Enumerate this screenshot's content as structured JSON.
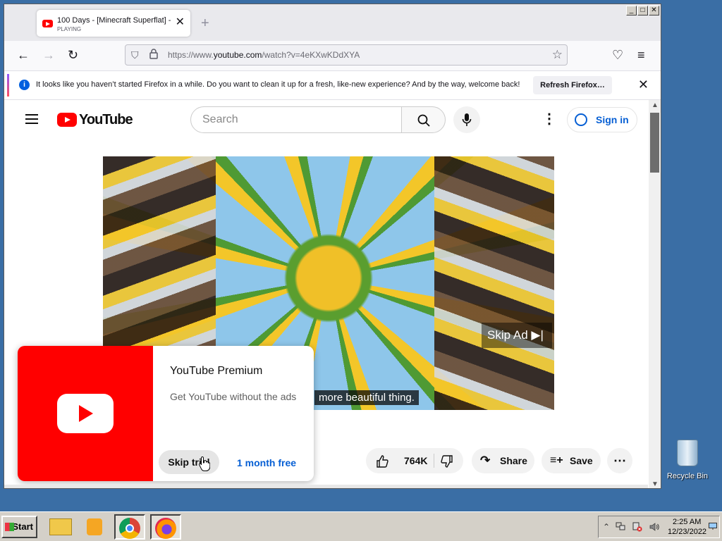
{
  "browser": {
    "tab": {
      "title": "100 Days - [Minecraft Superflat] -",
      "subtitle": "PLAYING",
      "close": "✕"
    },
    "new_tab": "+",
    "window_buttons": [
      "_",
      "□",
      "✕"
    ],
    "url": {
      "prefix": "https://www.",
      "domain": "youtube.com",
      "path": "/watch?v=4eKXwKDdXYA"
    },
    "nav": {
      "back": "←",
      "forward": "→",
      "reload": "↻",
      "pocket": "♡",
      "menu": "≡",
      "star": "☆",
      "shield": "⛉",
      "lock": "🔒"
    },
    "notification": {
      "icon": "i",
      "text": "It looks like you haven’t started Firefox in a while. Do you want to clean it up for a fresh, like-new experience? And by the way, welcome back!",
      "button": "Refresh Firefox…",
      "close": "✕"
    }
  },
  "youtube": {
    "wordmark": "YouTube",
    "search_placeholder": "Search",
    "search_icon": "⚲",
    "mic_icon": "🎤",
    "more_icon": "⋮",
    "sign_in": "Sign in",
    "video": {
      "caption": "more beautiful thing.",
      "skip_ad": "Skip Ad ▶|"
    },
    "actions": {
      "like_icon": "👍",
      "like_count": "764K",
      "dislike_icon": "👎",
      "share_icon": "↷",
      "share": "Share",
      "save_icon": "≡+",
      "save": "Save",
      "more": "⋯"
    },
    "premium": {
      "title": "YouTube Premium",
      "description": "Get YouTube without the ads",
      "skip": "Skip trial",
      "trial": "1 month free"
    }
  },
  "scrollbar": {
    "up": "▲",
    "down": "▼"
  },
  "desktop": {
    "recycle_bin": "Recycle Bin"
  },
  "taskbar": {
    "start": "Start",
    "tray": {
      "expand": "⌃",
      "time": "2:25 AM",
      "date": "12/23/2022"
    }
  },
  "colors": {
    "youtube_red": "#ff0000",
    "link_blue": "#065fd4",
    "desktop": "#3a6ea5",
    "taskbar": "#d4d0c8"
  }
}
